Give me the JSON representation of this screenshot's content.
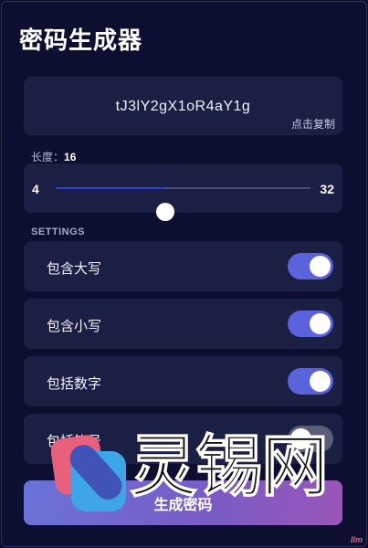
{
  "app": {
    "title": "密码生成器"
  },
  "password": {
    "value": "tJ3lY2gX1oR4aY1g",
    "copy_hint": "点击复制"
  },
  "length": {
    "label": "长度：",
    "value": "16",
    "min": "4",
    "max": "32",
    "current": 16
  },
  "settings": {
    "heading": "SETTINGS",
    "options": [
      {
        "label": "包含大写",
        "enabled": true
      },
      {
        "label": "包含小写",
        "enabled": true
      },
      {
        "label": "包括数字",
        "enabled": true
      },
      {
        "label": "包括符号",
        "enabled": false
      }
    ]
  },
  "generate_button": {
    "label": "生成密码"
  },
  "watermark": {
    "brand": "灵锡网",
    "site": "Ilm"
  },
  "colors": {
    "accent": "#5b63dc",
    "slider_fill": "#2a3bd6",
    "background": "#0d0f31",
    "card": "#1c1f44"
  }
}
